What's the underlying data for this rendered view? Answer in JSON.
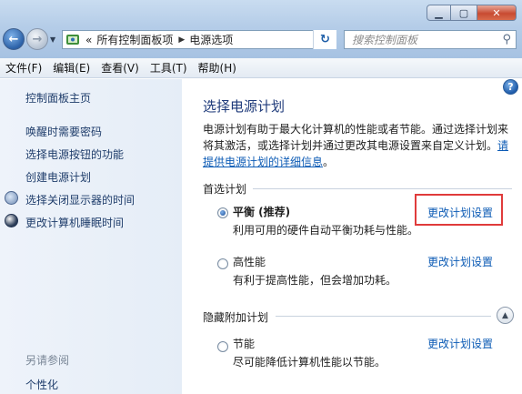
{
  "window": {
    "min_label": "▁",
    "max_label": "▢",
    "close_label": "✕"
  },
  "address": {
    "prefix": "«",
    "crumbs": [
      "所有控制面板项",
      "电源选项"
    ]
  },
  "search": {
    "placeholder": "搜索控制面板"
  },
  "menu": [
    "文件(F)",
    "编辑(E)",
    "查看(V)",
    "工具(T)",
    "帮助(H)"
  ],
  "sidebar": {
    "items": [
      {
        "label": "控制面板主页",
        "icon": null
      },
      {
        "label": "唤醒时需要密码",
        "icon": null
      },
      {
        "label": "选择电源按钮的功能",
        "icon": null
      },
      {
        "label": "创建电源计划",
        "icon": null
      },
      {
        "label": "选择关闭显示器的时间",
        "icon": "display-icon"
      },
      {
        "label": "更改计算机睡眠时间",
        "icon": "sleep-icon"
      }
    ],
    "see_also_title": "另请参阅",
    "see_also_items": [
      "个性化"
    ]
  },
  "main": {
    "title": "选择电源计划",
    "description": "电源计划有助于最大化计算机的性能或者节能。通过选择计划来将其激活，或选择计划并通过更改其电源设置来自定义计划。",
    "description_link": "请提供电源计划的详细信息",
    "description_end": "。",
    "preferred_section": "首选计划",
    "hidden_section": "隐藏附加计划",
    "plans": [
      {
        "name": "平衡 (推荐)",
        "desc": "利用可用的硬件自动平衡功耗与性能。",
        "link": "更改计划设置",
        "selected": true
      },
      {
        "name": "高性能",
        "desc": "有利于提高性能，但会增加功耗。",
        "link": "更改计划设置",
        "selected": false
      }
    ],
    "hidden_plans": [
      {
        "name": "节能",
        "desc": "尽可能降低计算机性能以节能。",
        "link": "更改计划设置",
        "selected": false
      }
    ]
  },
  "colors": {
    "link": "#0c5bb5",
    "highlight_box": "#e03b3b",
    "title": "#1e3a7a"
  }
}
